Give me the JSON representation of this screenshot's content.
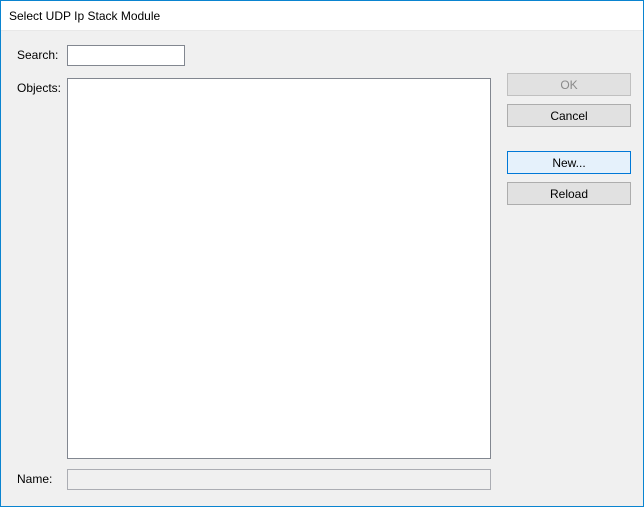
{
  "window": {
    "title": "Select UDP Ip Stack Module"
  },
  "labels": {
    "search": "Search:",
    "objects": "Objects:",
    "name": "Name:"
  },
  "fields": {
    "search_value": "",
    "name_value": ""
  },
  "buttons": {
    "ok": "OK",
    "cancel": "Cancel",
    "new": "New...",
    "reload": "Reload"
  },
  "objects_items": []
}
